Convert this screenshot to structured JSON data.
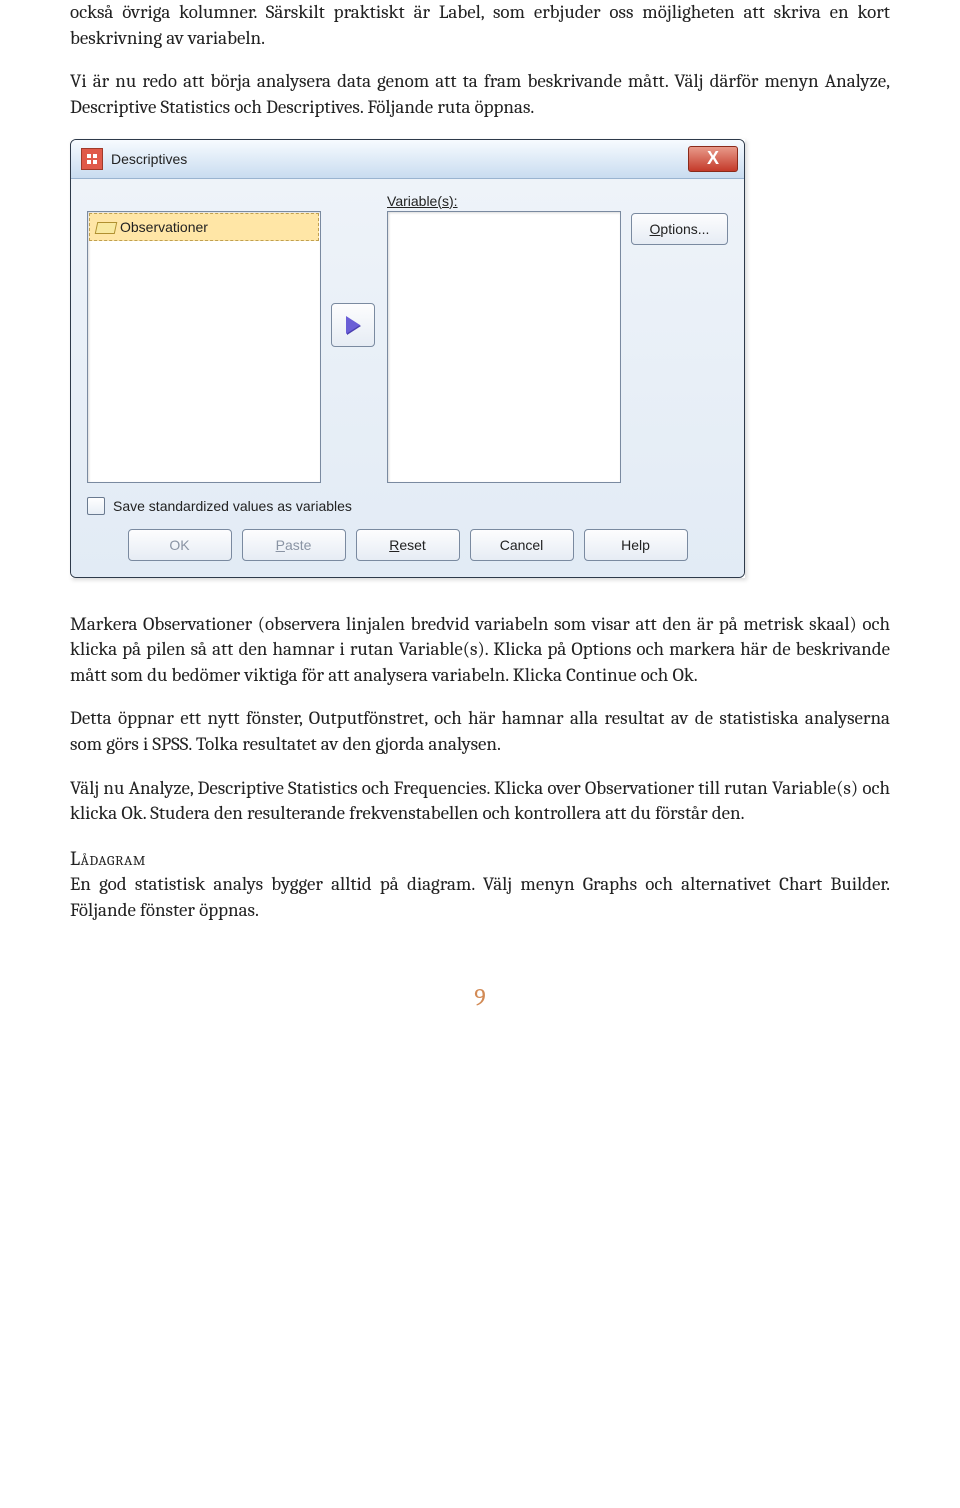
{
  "para1": "också övriga kolumner. Särskilt praktiskt är Label, som erbjuder oss möjligheten att skriva en kort beskrivning av variabeln.",
  "para2": "Vi är nu redo att börja analysera data genom att ta fram beskrivande mått. Välj därför menyn Analyze, Descriptive Statistics och Descriptives. Följande ruta öppnas.",
  "dialog": {
    "title": "Descriptives",
    "close_symbol": "X",
    "variables_label": "Variable(s):",
    "options_label": "Options...",
    "source_item": "Observationer",
    "save_std_label": "Save standardized values as variables",
    "buttons": {
      "ok": "OK",
      "paste": "Paste",
      "reset": "Reset",
      "cancel": "Cancel",
      "help": "Help"
    }
  },
  "para3": "Markera Observationer (observera linjalen bredvid variabeln som visar att den är på metrisk skaal) och klicka på pilen så att den hamnar i rutan Variable(s). Klicka på Options och markera här de beskrivande mått som du bedömer viktiga för att analysera variabeln. Klicka Continue och Ok.",
  "para4": "Detta öppnar ett nytt fönster, Outputfönstret, och här hamnar alla resultat av de statistiska analyserna som görs i SPSS. Tolka resultatet av den gjorda analysen.",
  "para5": "Välj nu Analyze, Descriptive Statistics och Frequencies. Klicka over Observationer till rutan Variable(s) och klicka Ok. Studera den resulterande frekvenstabellen och kontrollera att du förstår den.",
  "heading": "Lådagram",
  "para6": "En god statistisk analys bygger alltid på diagram. Välj menyn Graphs och alternativet Chart Builder. Följande fönster öppnas.",
  "page_number": "9"
}
